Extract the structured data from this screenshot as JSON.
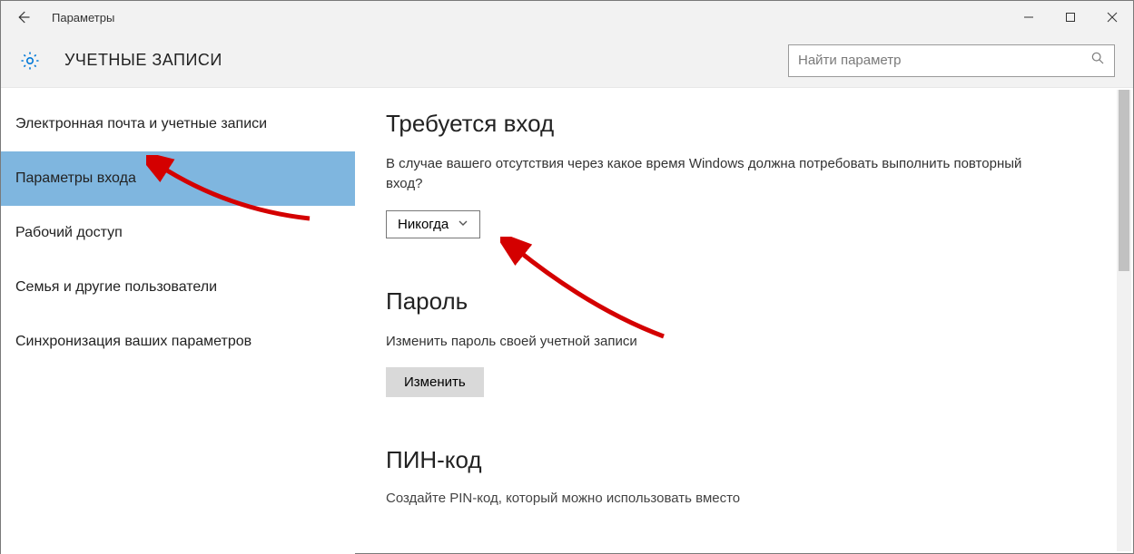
{
  "window": {
    "title": "Параметры"
  },
  "header": {
    "heading": "УЧЕТНЫЕ ЗАПИСИ",
    "search_placeholder": "Найти параметр"
  },
  "sidebar": {
    "items": [
      {
        "label": "Электронная почта и учетные записи",
        "selected": false
      },
      {
        "label": "Параметры входа",
        "selected": true
      },
      {
        "label": "Рабочий доступ",
        "selected": false
      },
      {
        "label": "Семья и другие пользователи",
        "selected": false
      },
      {
        "label": "Синхронизация ваших параметров",
        "selected": false
      }
    ]
  },
  "content": {
    "signin_required": {
      "heading": "Требуется вход",
      "description": "В случае вашего отсутствия через какое время Windows должна потребовать выполнить повторный вход?",
      "dropdown_value": "Никогда"
    },
    "password": {
      "heading": "Пароль",
      "description": "Изменить пароль своей учетной записи",
      "button": "Изменить"
    },
    "pin": {
      "heading": "ПИН-код",
      "truncated": "Создайте PIN-код, который можно использовать вместо"
    }
  }
}
